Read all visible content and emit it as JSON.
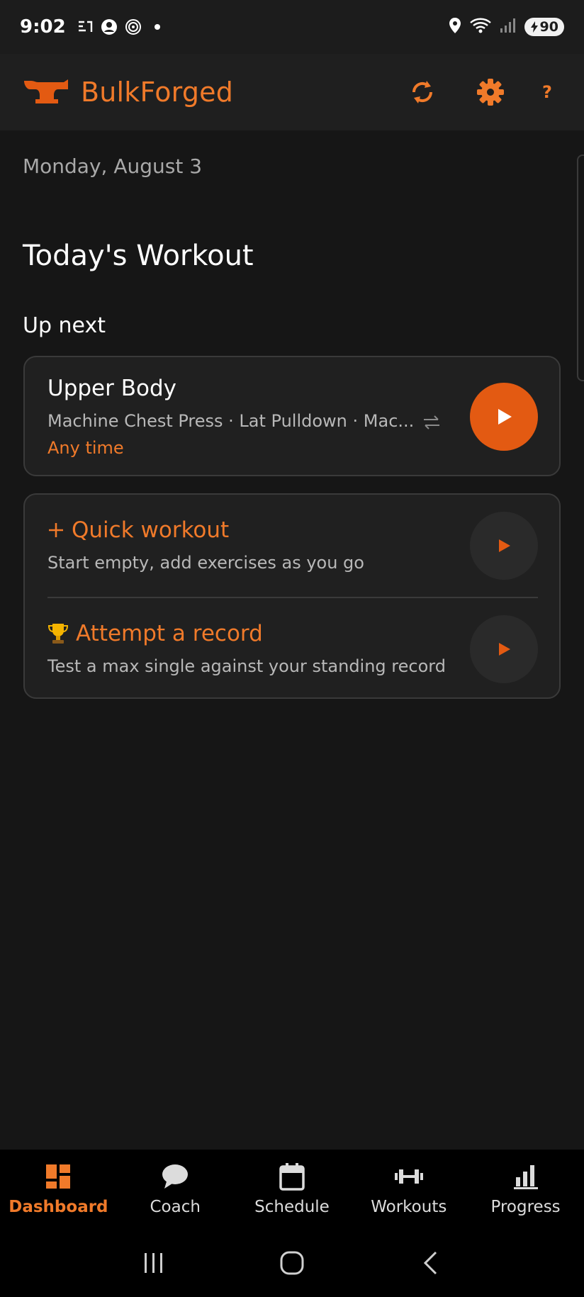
{
  "status_bar": {
    "time": "9:02",
    "battery": "90",
    "icons": [
      "assistant-icon",
      "account-circle-icon",
      "at-sign-icon",
      "dot-icon",
      "location-icon",
      "wifi-icon",
      "signal-icon",
      "battery-charging-icon"
    ]
  },
  "app_bar": {
    "title": "BulkForged",
    "help_label": "?",
    "accent_color": "#f07a2a"
  },
  "dashboard": {
    "date": "Monday, August 3",
    "title": "Today's Workout",
    "up_next_label": "Up next",
    "up_next": {
      "name": "Upper Body",
      "exercises": "Machine Chest Press · Lat Pulldown · Mac...",
      "time": "Any time"
    },
    "quick_workout": {
      "title": "Quick workout",
      "subtitle": "Start empty, add exercises as you go"
    },
    "attempt_record": {
      "title": "Attempt a record",
      "subtitle": "Test a max single against your standing record"
    }
  },
  "bottom_nav": {
    "items": [
      {
        "label": "Dashboard",
        "icon": "dashboard-icon",
        "active": true
      },
      {
        "label": "Coach",
        "icon": "chat-bubble-icon",
        "active": false
      },
      {
        "label": "Schedule",
        "icon": "calendar-icon",
        "active": false
      },
      {
        "label": "Workouts",
        "icon": "dumbbell-icon",
        "active": false
      },
      {
        "label": "Progress",
        "icon": "bar-chart-icon",
        "active": false
      }
    ]
  },
  "colors": {
    "accent": "#f07a2a",
    "play_button": "#e35a12",
    "background": "#161616",
    "card": "#202020"
  }
}
